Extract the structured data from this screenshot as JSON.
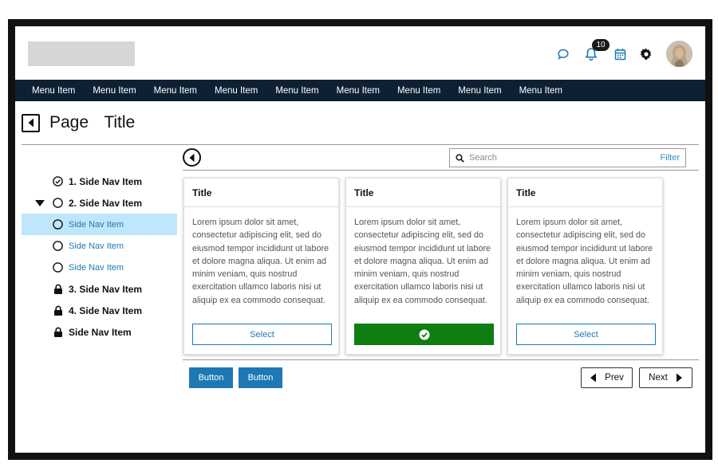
{
  "header": {
    "notifications_count": "10",
    "icons": [
      "chat-bubble-icon",
      "bell-icon",
      "calendar-icon",
      "gear-icon"
    ]
  },
  "menu": {
    "items": [
      "Menu Item",
      "Menu Item",
      "Menu Item",
      "Menu Item",
      "Menu Item",
      "Menu Item",
      "Menu Item",
      "Menu Item",
      "Menu Item"
    ]
  },
  "page": {
    "title": "Page  Title"
  },
  "search": {
    "placeholder": "Search",
    "filter_label": "Filter"
  },
  "sidenav": {
    "items": [
      {
        "label": "1. Side Nav Item",
        "state": "complete"
      },
      {
        "label": "2. Side Nav Item",
        "state": "expanded"
      },
      {
        "label": "Side Nav Item",
        "state": "selected"
      },
      {
        "label": "Side Nav Item",
        "state": "sub"
      },
      {
        "label": "Side Nav Item",
        "state": "sub"
      },
      {
        "label": "3. Side Nav Item",
        "state": "locked"
      },
      {
        "label": "4. Side Nav Item",
        "state": "locked"
      },
      {
        "label": "Side Nav Item",
        "state": "locked"
      }
    ]
  },
  "cards": [
    {
      "title": "Title",
      "body": "Lorem ipsum dolor sit amet, consectetur adipiscing elit, sed do eiusmod tempor incididunt ut labore et dolore magna aliqua. Ut enim ad minim veniam, quis nostrud exercitation ullamco laboris nisi ut aliquip ex ea commodo consequat.",
      "button": "Select",
      "selected": false
    },
    {
      "title": "Title",
      "body": "Lorem ipsum dolor sit amet, consectetur adipiscing elit, sed do eiusmod tempor incididunt ut labore et dolore magna aliqua. Ut enim ad minim veniam, quis nostrud exercitation ullamco laboris nisi ut aliquip ex ea commodo consequat.",
      "button": "",
      "selected": true
    },
    {
      "title": "Title",
      "body": "Lorem ipsum dolor sit amet, consectetur adipiscing elit, sed do eiusmod tempor incididunt ut labore et dolore magna aliqua. Ut enim ad minim veniam, quis nostrud exercitation ullamco laboris nisi ut aliquip ex ea commodo consequat.",
      "button": "Select",
      "selected": false
    }
  ],
  "actions": {
    "button1": "Button",
    "button2": "Button",
    "prev": "Prev",
    "next": "Next"
  },
  "colors": {
    "menubar": "#0e2033",
    "accent": "#1e78b4",
    "selected_green": "#0f7d0f",
    "nav_selected_bg": "#bfe6fa"
  }
}
